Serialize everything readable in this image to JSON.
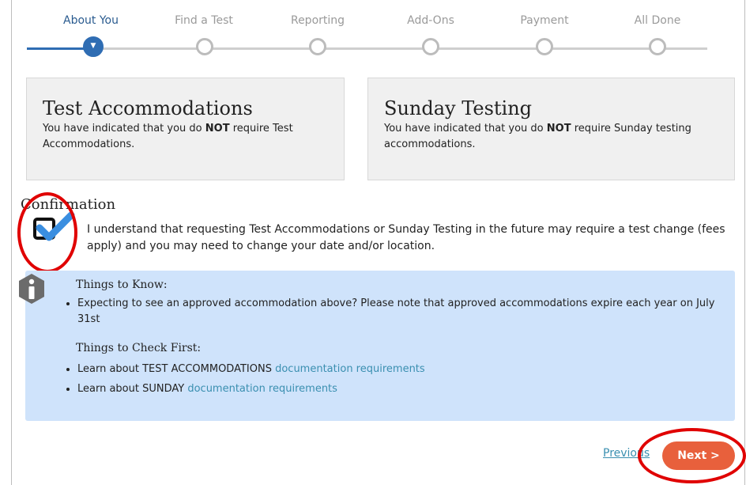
{
  "stepper": {
    "steps": [
      {
        "label": "About You",
        "active": true
      },
      {
        "label": "Find a Test",
        "active": false
      },
      {
        "label": "Reporting",
        "active": false
      },
      {
        "label": "Add-Ons",
        "active": false
      },
      {
        "label": "Payment",
        "active": false
      },
      {
        "label": "All Done",
        "active": false
      }
    ],
    "active_icon": "chevron-down-icon"
  },
  "cards": [
    {
      "title": "Test Accommodations",
      "text_pre": "You have indicated that you do ",
      "text_bold": "NOT",
      "text_post": " require Test Accommodations."
    },
    {
      "title": "Sunday Testing",
      "text_pre": "You have indicated that you do ",
      "text_bold": "NOT",
      "text_post": " require Sunday testing accommodations."
    }
  ],
  "confirmation": {
    "title": "Confirmation",
    "checked": true,
    "text": "I understand that requesting Test Accommodations or Sunday Testing in the future may require a test change (fees apply) and you may need to change your date and/or location."
  },
  "info": {
    "icon": "info-icon",
    "things_to_know_title": "Things to Know:",
    "things_to_know": [
      "Expecting to see an approved accommodation above? Please note that approved accommodations expire each year on July 31st"
    ],
    "things_to_check_title": "Things to Check First:",
    "checks": [
      {
        "pre": "Learn about TEST ACCOMMODATIONS ",
        "link": "documentation requirements"
      },
      {
        "pre": "Learn about SUNDAY ",
        "link": "documentation requirements"
      }
    ]
  },
  "nav": {
    "previous_label": "Previous",
    "next_label": "Next >"
  },
  "colors": {
    "accent_blue": "#2f6db3",
    "next_button": "#e8603c",
    "info_bg": "#cfe3fb",
    "link": "#3a8fb0",
    "annotation_red": "#e00000"
  }
}
